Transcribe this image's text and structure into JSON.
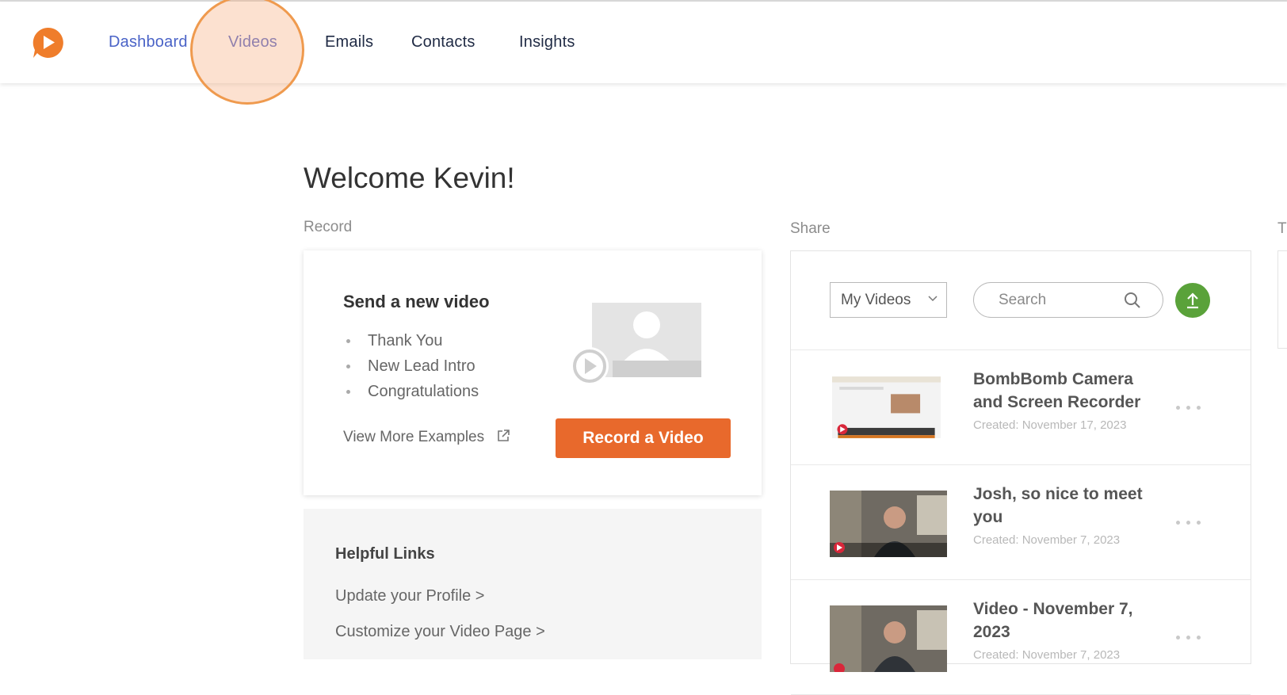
{
  "nav": {
    "items": [
      "Dashboard",
      "Videos",
      "Emails",
      "Contacts",
      "Insights"
    ],
    "active": "Videos"
  },
  "welcome": "Welcome Kevin!",
  "sections": {
    "record": "Record",
    "share": "Share",
    "third": "Tr"
  },
  "record_card": {
    "title": "Send a new video",
    "examples": [
      "Thank You",
      "New Lead Intro",
      "Congratulations"
    ],
    "view_more": "View More Examples",
    "button": "Record a Video"
  },
  "helpful_links": {
    "title": "Helpful Links",
    "links": [
      "Update your Profile >",
      "Customize your Video Page >"
    ]
  },
  "share": {
    "filter_value": "My Videos",
    "search_placeholder": "Search",
    "videos": [
      {
        "title": "BombBomb Camera and Screen Recorder",
        "date": "Created: November 17, 2023"
      },
      {
        "title": "Josh, so nice to meet you",
        "date": "Created: November 7, 2023"
      },
      {
        "title": "Video - November 7, 2023",
        "date": "Created: November 7, 2023"
      }
    ]
  },
  "colors": {
    "brand_orange": "#e8692c",
    "nav_link": "#4a63c7",
    "upload_green": "#5aa23a",
    "click_highlight": "#ef9a4e"
  },
  "icons": [
    "logo-icon",
    "external-link-icon",
    "chevron-down-icon",
    "search-icon",
    "upload-icon",
    "more-icon",
    "play-icon"
  ]
}
